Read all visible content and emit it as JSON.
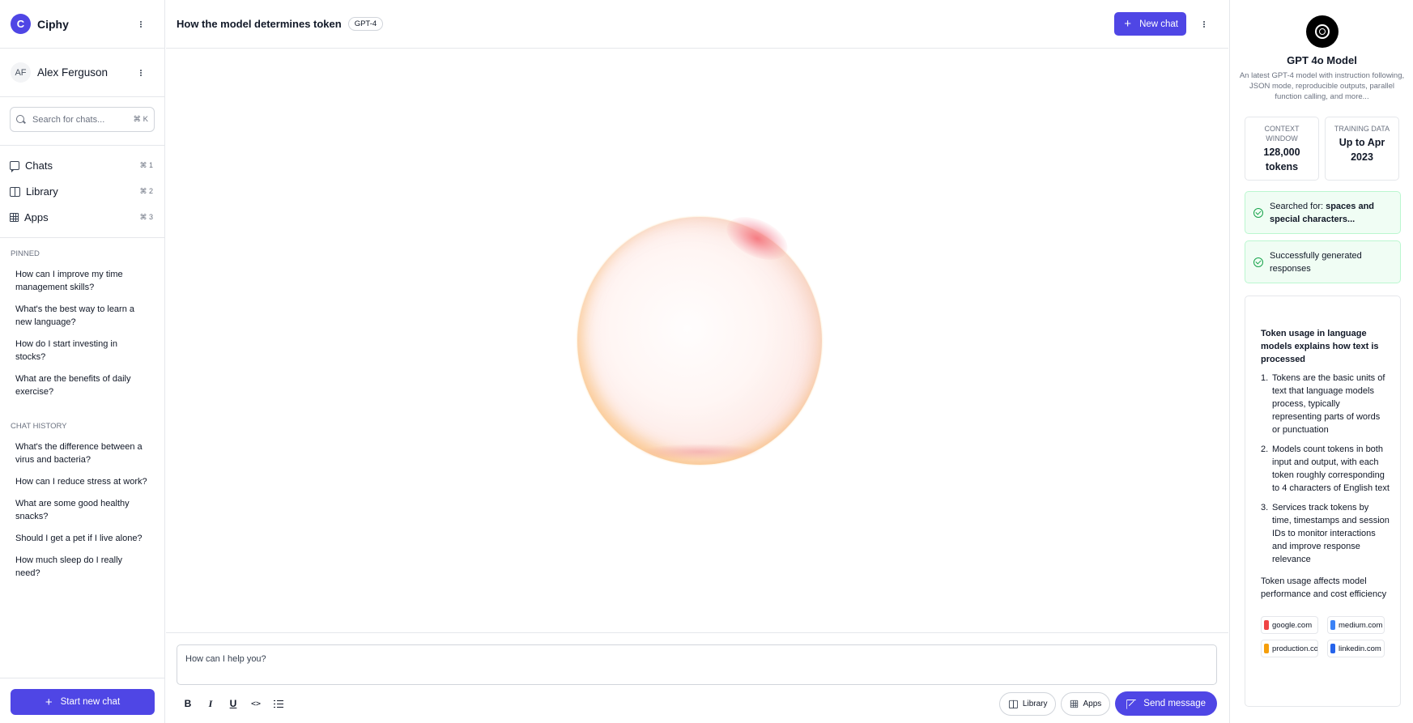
{
  "sidebar": {
    "brand": {
      "logo_letter": "C",
      "name": "Ciphy"
    },
    "user": {
      "initials": "AF",
      "name": "Alex Ferguson"
    },
    "search": {
      "placeholder": "Search for chats...",
      "shortcut": "⌘ K"
    },
    "nav": [
      {
        "label": "Chats",
        "shortcut": "⌘ 1",
        "icon": "chat-bubble-icon"
      },
      {
        "label": "Library",
        "shortcut": "⌘ 2",
        "icon": "book-icon"
      },
      {
        "label": "Apps",
        "shortcut": "⌘ 3",
        "icon": "grid-icon"
      }
    ],
    "pinned": {
      "title": "PINNED",
      "items": [
        "How can I improve my time management skills?",
        "What's the best way to learn a new language?",
        "How do I start investing in stocks?",
        "What are the benefits of daily exercise?"
      ]
    },
    "history": {
      "title": "CHAT HISTORY",
      "items": [
        "What's the difference between a virus and bacteria?",
        "How can I reduce stress at work?",
        "What are some good healthy snacks?",
        "Should I get a pet if I live alone?",
        "How much sleep do I really need?"
      ]
    },
    "start_button": "Start new chat"
  },
  "header": {
    "title": "How the model determines token",
    "model_badge": "GPT-4",
    "new_chat": "New chat"
  },
  "composer": {
    "placeholder": "How can I help you?",
    "library": "Library",
    "apps": "Apps",
    "send": "Send message",
    "format_tools": [
      "B",
      "I",
      "U",
      "<>"
    ]
  },
  "panel": {
    "model_name": "GPT 4o Model",
    "model_desc": "An latest GPT-4 model with instruction following, JSON mode, reproducible outputs, parallel function calling, and more...",
    "stats": [
      {
        "label": "CONTEXT WINDOW",
        "value": "128,000 tokens"
      },
      {
        "label": "TRAINING DATA",
        "value": "Up to Apr 2023"
      }
    ],
    "status_search": {
      "prefix": "Searched for: ",
      "query": "spaces and special characters..."
    },
    "status_done": "Successfully generated responses",
    "card": {
      "title": "Token usage in language models explains how text is processed",
      "points": [
        {
          "num": "1.",
          "text": "Tokens are the basic units of text that language models process, typically representing parts of words or punctuation"
        },
        {
          "num": "2.",
          "text": "Models count tokens in both input and output, with each token roughly corresponding to 4 characters of English text"
        },
        {
          "num": "3.",
          "text": "Services track tokens by time, timestamps and session IDs to monitor interactions and improve response relevance"
        }
      ],
      "footer": "Token usage affects model performance and cost efficiency",
      "sources": [
        {
          "name": "google.com",
          "color": "#ef4444"
        },
        {
          "name": "medium.com",
          "color": "#3b82f6"
        },
        {
          "name": "production.com",
          "color": "#f59e0b"
        },
        {
          "name": "linkedin.com",
          "color": "#2563eb"
        }
      ]
    }
  },
  "colors": {
    "accent": "#4f46e5",
    "success": "#16a34a"
  }
}
